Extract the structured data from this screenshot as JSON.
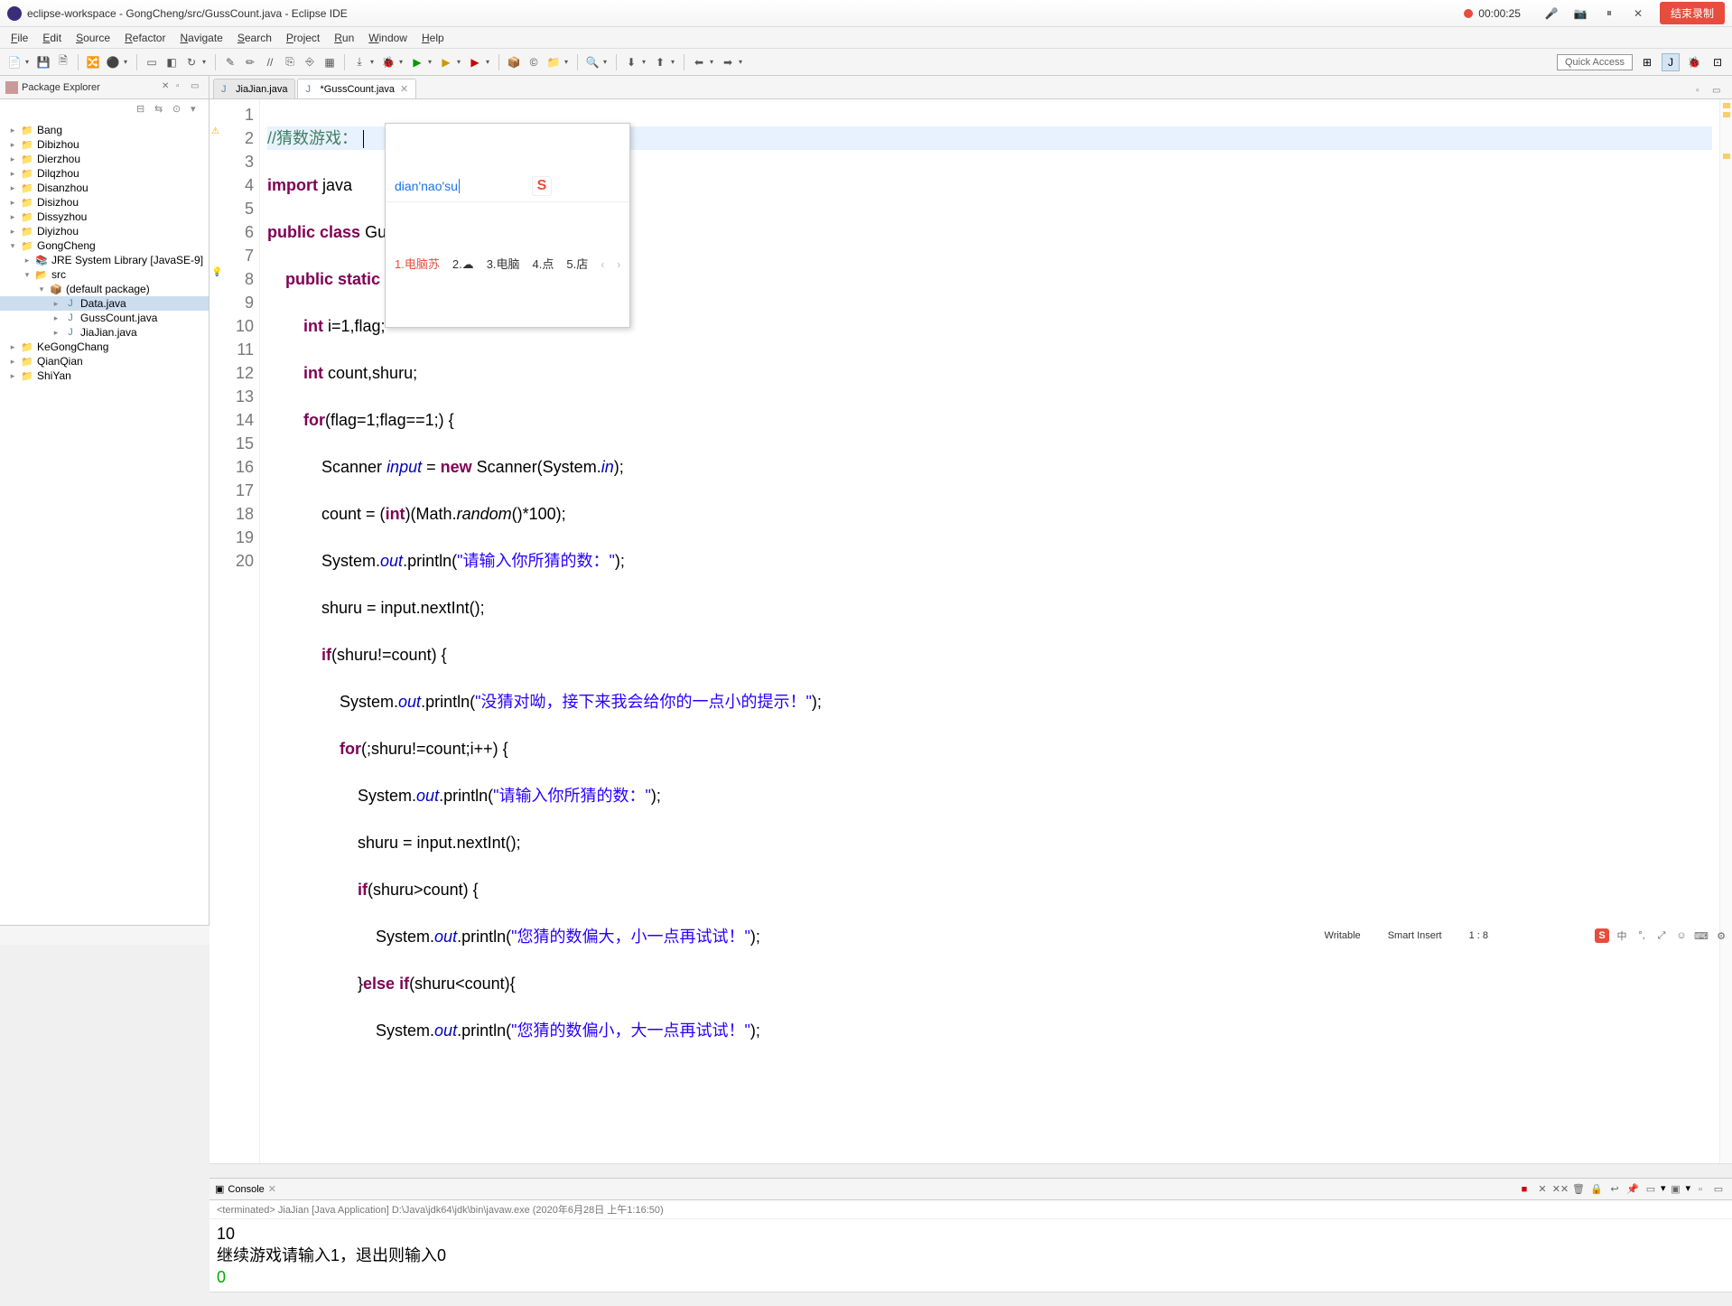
{
  "window": {
    "title": "eclipse-workspace - GongCheng/src/GussCount.java - Eclipse IDE",
    "rec_time": "00:00:25",
    "end_rec_label": "结束录制"
  },
  "menu": [
    "File",
    "Edit",
    "Source",
    "Refactor",
    "Navigate",
    "Search",
    "Project",
    "Run",
    "Window",
    "Help"
  ],
  "quick_access": "Quick Access",
  "pkg_explorer": {
    "title": "Package Explorer",
    "items": [
      {
        "lvl": 0,
        "arrow": ">",
        "icon": "proj",
        "label": "Bang"
      },
      {
        "lvl": 0,
        "arrow": ">",
        "icon": "proj",
        "label": "Dibizhou"
      },
      {
        "lvl": 0,
        "arrow": ">",
        "icon": "proj",
        "label": "Dierzhou"
      },
      {
        "lvl": 0,
        "arrow": ">",
        "icon": "proj",
        "label": "Dilqzhou"
      },
      {
        "lvl": 0,
        "arrow": ">",
        "icon": "proj",
        "label": "Disanzhou"
      },
      {
        "lvl": 0,
        "arrow": ">",
        "icon": "proj",
        "label": "Disizhou"
      },
      {
        "lvl": 0,
        "arrow": ">",
        "icon": "proj",
        "label": "Dissyzhou"
      },
      {
        "lvl": 0,
        "arrow": ">",
        "icon": "proj",
        "label": "Diyizhou"
      },
      {
        "lvl": 0,
        "arrow": "v",
        "icon": "proj",
        "label": "GongCheng"
      },
      {
        "lvl": 1,
        "arrow": ">",
        "icon": "lib",
        "label": "JRE System Library [JavaSE-9]"
      },
      {
        "lvl": 1,
        "arrow": "v",
        "icon": "folder",
        "label": "src"
      },
      {
        "lvl": 2,
        "arrow": "v",
        "icon": "pkg",
        "label": "(default package)"
      },
      {
        "lvl": 3,
        "arrow": ">",
        "icon": "java",
        "label": "Data.java",
        "selected": true
      },
      {
        "lvl": 3,
        "arrow": ">",
        "icon": "java",
        "label": "GussCount.java"
      },
      {
        "lvl": 3,
        "arrow": ">",
        "icon": "java",
        "label": "JiaJian.java"
      },
      {
        "lvl": 0,
        "arrow": ">",
        "icon": "proj",
        "label": "KeGongChang"
      },
      {
        "lvl": 0,
        "arrow": ">",
        "icon": "proj",
        "label": "QianQian"
      },
      {
        "lvl": 0,
        "arrow": ">",
        "icon": "proj",
        "label": "ShiYan"
      }
    ]
  },
  "editor": {
    "tabs": [
      {
        "label": "JiaJian.java",
        "active": false,
        "dirty": false
      },
      {
        "label": "*GussCount.java",
        "active": true,
        "dirty": true
      }
    ],
    "lines": [
      1,
      2,
      3,
      4,
      5,
      6,
      7,
      8,
      9,
      10,
      11,
      12,
      13,
      14,
      15,
      16,
      17,
      18,
      19,
      20
    ],
    "ime": {
      "input": "dian'nao'su",
      "candidates": [
        "1.电脑苏",
        "2.☁",
        "3.电脑",
        "4.点",
        "5.店"
      ]
    },
    "code": {
      "l1_comment": "//猜数游戏：",
      "l2_pre": "import",
      "l2_text": " java",
      "l3": "public class GussCount {",
      "l4": "    public static void main(String[] args) {",
      "l5": "        int i=1,flag;",
      "l6": "        int count,shuru;",
      "l7": "        for(flag=1;flag==1;) {",
      "l8_a": "            Scanner ",
      "l8_b": "input",
      "l8_c": " = ",
      "l8_d": "new",
      "l8_e": " Scanner(System.",
      "l8_f": "in",
      "l8_g": ");",
      "l9_a": "            count = (",
      "l9_b": "int",
      "l9_c": ")(Math.",
      "l9_d": "random",
      "l9_e": "()*100);",
      "l10_a": "            System.",
      "l10_b": "out",
      "l10_c": ".println(",
      "l10_d": "\"请输入你所猜的数：\"",
      "l10_e": ");",
      "l11": "            shuru = input.nextInt();",
      "l12_a": "            ",
      "l12_b": "if",
      "l12_c": "(shuru!=count) {",
      "l13_a": "                System.",
      "l13_b": "out",
      "l13_c": ".println(",
      "l13_d": "\"没猜对呦，接下来我会给你的一点小的提示！\"",
      "l13_e": ");",
      "l14_a": "                ",
      "l14_b": "for",
      "l14_c": "(;shuru!=count;i++) {",
      "l15_a": "                    System.",
      "l15_b": "out",
      "l15_c": ".println(",
      "l15_d": "\"请输入你所猜的数：\"",
      "l15_e": ");",
      "l16": "                    shuru = input.nextInt();",
      "l17_a": "                    ",
      "l17_b": "if",
      "l17_c": "(shuru>count) {",
      "l18_a": "                        System.",
      "l18_b": "out",
      "l18_c": ".println(",
      "l18_d": "\"您猜的数偏大，小一点再试试！\"",
      "l18_e": ");",
      "l19_a": "                    }",
      "l19_b": "else if",
      "l19_c": "(shuru<count){",
      "l20_a": "                        System.",
      "l20_b": "out",
      "l20_c": ".println(",
      "l20_d": "\"您猜的数偏小，大一点再试试！\"",
      "l20_e": ");"
    }
  },
  "console": {
    "title": "Console",
    "info": "<terminated> JiaJian [Java Application] D:\\Java\\jdk64\\jdk\\bin\\javaw.exe (2020年6月28日 上午1:16:50)",
    "lines": [
      {
        "text": "10",
        "cls": ""
      },
      {
        "text": "继续游戏请输入1，退出则输入0",
        "cls": ""
      },
      {
        "text": "0",
        "cls": "user-in"
      }
    ]
  },
  "status": {
    "writable": "Writable",
    "insert": "Smart Insert",
    "pos": "1 : 8"
  },
  "tray": {
    "ime_mode": "中",
    "punct": "°,",
    "fullwidth": "⤢",
    "emoji": "☺",
    "tools": "⚙"
  }
}
